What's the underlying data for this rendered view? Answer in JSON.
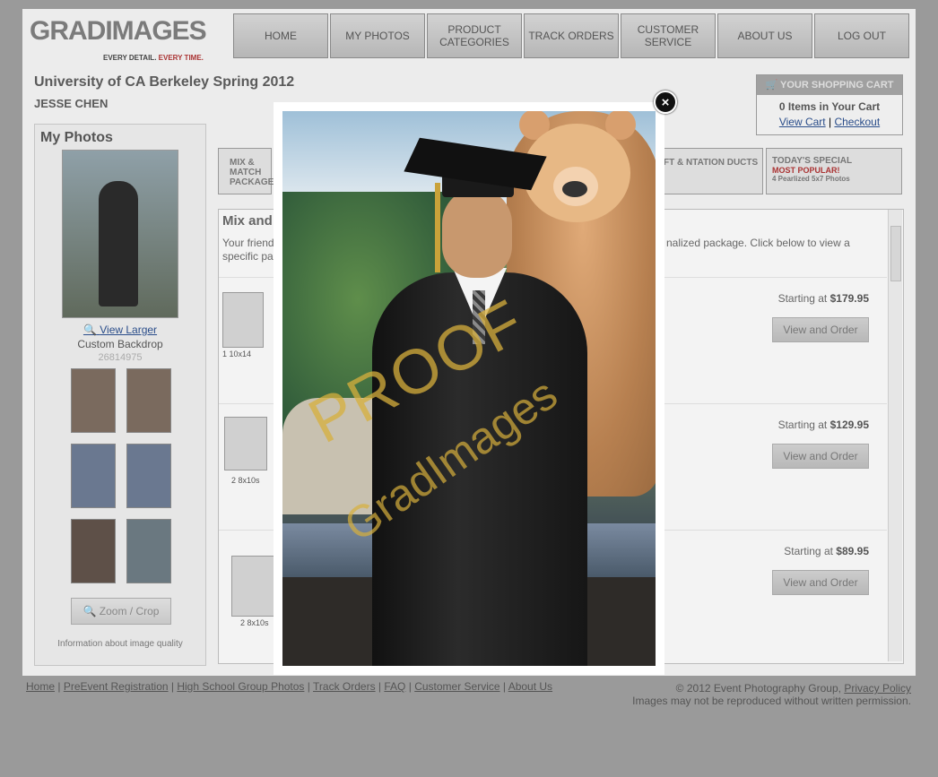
{
  "brand": {
    "name_part1": "GRAD",
    "name_part2": "IMAGES",
    "tagline_a": "EVERY DETAIL.",
    "tagline_b": "EVERY TIME."
  },
  "nav": [
    "HOME",
    "MY PHOTOS",
    "PRODUCT CATEGORIES",
    "TRACK ORDERS",
    "CUSTOMER SERVICE",
    "ABOUT US",
    "LOG OUT"
  ],
  "event": {
    "title": "University of CA Berkeley Spring 2012",
    "name": "JESSE CHEN"
  },
  "cart": {
    "header": "YOUR SHOPPING CART",
    "items": "0 Items in Your Cart",
    "view": "View Cart",
    "sep": "|",
    "checkout": "Checkout"
  },
  "sidebar": {
    "title": "My Photos",
    "view_larger": "View Larger",
    "backdrop": "Custom Backdrop",
    "id": "26814975",
    "zoom": "Zoom / Crop",
    "info": "Information about image quality"
  },
  "banners": {
    "mix": "MIX & MATCH PACKAGES",
    "gift": "FT & NTATION DUCTS",
    "special_title": "TODAY'S SPECIAL",
    "special_sub": "MOST POPULAR!",
    "special_desc": "4 Pearlized 5x7 Photos"
  },
  "content": {
    "heading": "Mix and",
    "desc_left": "Your friend",
    "desc_left2": "specific pa",
    "desc_right": "nalized package. Click below to view a"
  },
  "packages": [
    {
      "label": "1  10x14",
      "price_prefix": "Starting at",
      "price": "$179.95",
      "button": "View and Order"
    },
    {
      "label": "2  8x10s",
      "price_prefix": "Starting at",
      "price": "$129.95",
      "button": "View and Order"
    },
    {
      "label": "2  8x10s",
      "price_prefix": "Starting at",
      "price": "$89.95",
      "button": "View and Order"
    }
  ],
  "footer": {
    "links": [
      "Home",
      "PreEvent Registration",
      "High School Group Photos",
      "Track Orders",
      "FAQ",
      "Customer Service",
      "About Us"
    ],
    "copyright": "© 2012 Event Photography Group,",
    "privacy": "Privacy Policy",
    "notice": "Images may not be reproduced without written permission."
  },
  "lightbox": {
    "watermark": "PROOF",
    "watermark2": "GradImages",
    "close": "×"
  }
}
